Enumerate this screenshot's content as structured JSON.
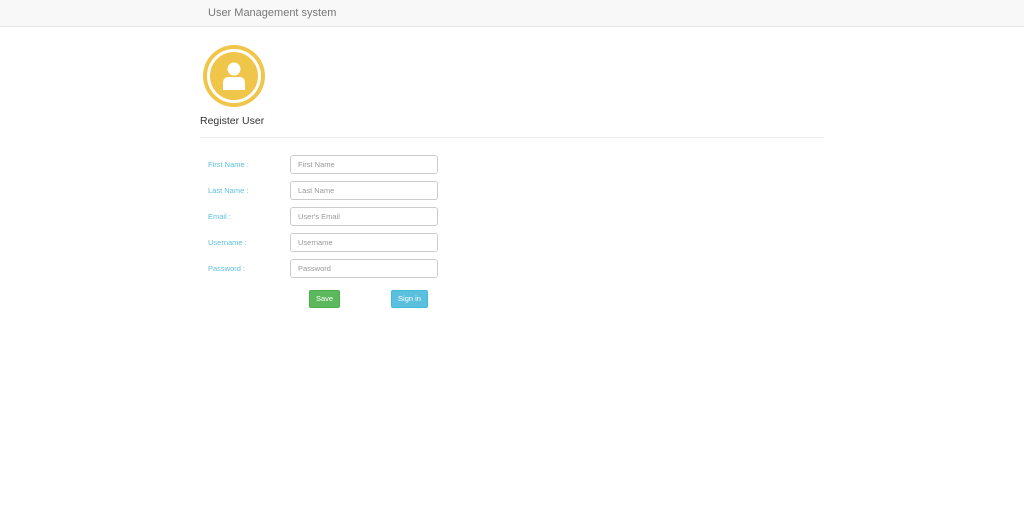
{
  "app": {
    "title": "User Management system"
  },
  "header": {
    "avatar_icon": "user-circle-icon",
    "avatar_color": "#f0c64a",
    "section_title": "Register User"
  },
  "form": {
    "fields": [
      {
        "label": "First Name :",
        "placeholder": "First Name",
        "value": ""
      },
      {
        "label": "Last Name :",
        "placeholder": "Last Name",
        "value": ""
      },
      {
        "label": "Email :",
        "placeholder": "User's Email",
        "value": ""
      },
      {
        "label": "Username :",
        "placeholder": "Username",
        "value": ""
      },
      {
        "label": "Password :",
        "placeholder": "Password",
        "value": ""
      }
    ],
    "save_label": "Save",
    "signin_label": "Sign in"
  },
  "colors": {
    "label": "#5bc0de",
    "save": "#5cb85c",
    "signin": "#5bc0de"
  }
}
